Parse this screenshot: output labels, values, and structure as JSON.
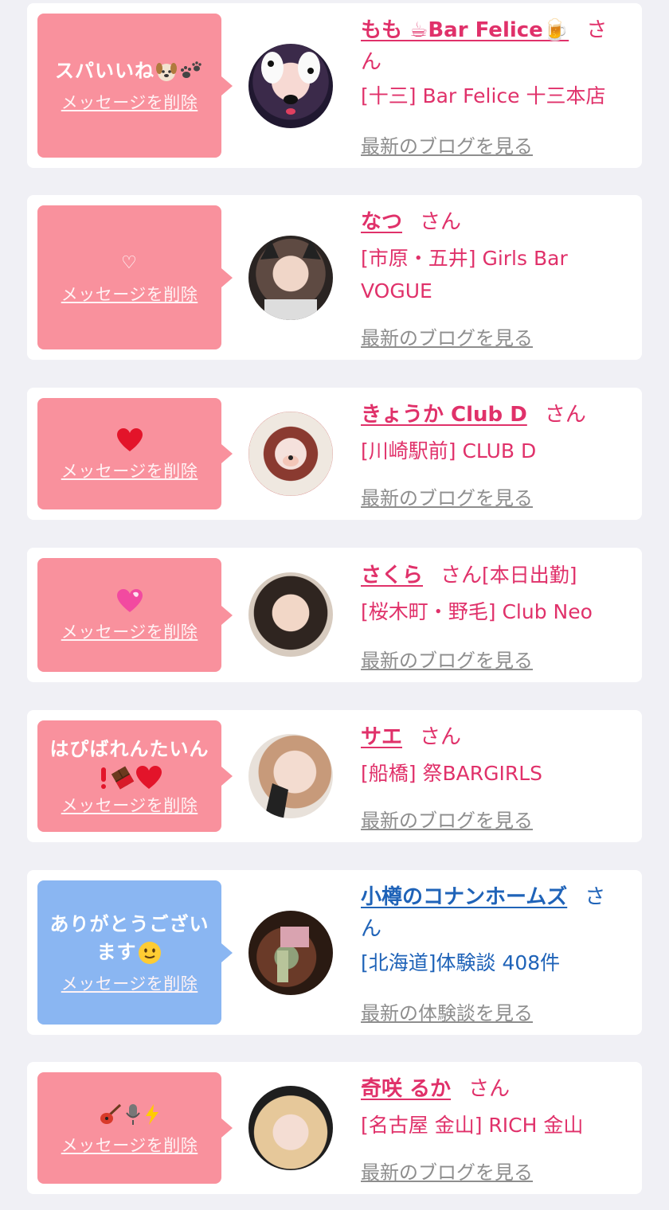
{
  "delete_label": "メッセージを削除",
  "san": "さん",
  "cards": [
    {
      "message_text": "スパいいね",
      "message_icons": [
        "dog-face-icon",
        "paw-prints-icon"
      ],
      "name": "もも ☕Bar Felice🍺",
      "name_tail": "さ",
      "name_wrap": "ん",
      "shop": "[十三] Bar Felice 十三本店",
      "link": "最新のブログを見る"
    },
    {
      "message_text": "♡",
      "name": "なつ",
      "shop_line1": "[市原・五井] Girls Bar",
      "shop_line2": "VOGUE",
      "link": "最新のブログを見る"
    },
    {
      "message_text": "",
      "message_icons": [
        "red-heart-icon"
      ],
      "name": "きょうか Club D",
      "shop": "[川崎駅前] CLUB D",
      "link": "最新のブログを見る"
    },
    {
      "message_text": "",
      "message_icons": [
        "heart-with-ribbon-icon"
      ],
      "name": "さくら",
      "status": "[本日出勤]",
      "shop": "[桜木町・野毛] Club Neo",
      "link": "最新のブログを見る"
    },
    {
      "message_line1": "はぴばれんたいん",
      "message_icons": [
        "exclamation-icon",
        "chocolate-bar-icon",
        "red-heart-icon"
      ],
      "name": "サエ",
      "shop": "[船橋] 祭BARGIRLS",
      "link": "最新のブログを見る"
    },
    {
      "message_line1": "ありがとうござい",
      "message_line2": "ます",
      "message_icons": [
        "smiling-face-icon"
      ],
      "name": "小樽のコナンホームズ",
      "name_tail": "さ",
      "name_wrap": "ん",
      "shop": "[北海道]体験談 408件",
      "link": "最新の体験談を見る"
    },
    {
      "message_text": "",
      "message_icons": [
        "guitar-icon",
        "microphone-icon",
        "lightning-icon"
      ],
      "name": "奇咲 るか",
      "shop": "[名古屋 金山] RICH 金山",
      "link": "最新のブログを見る"
    }
  ]
}
